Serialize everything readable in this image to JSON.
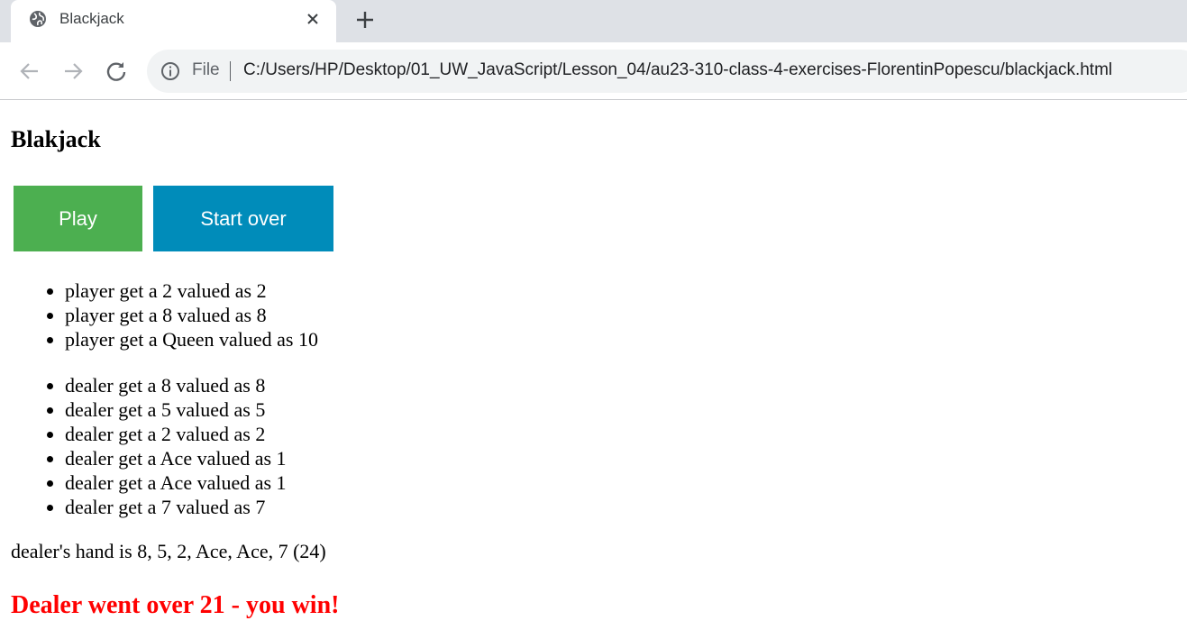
{
  "browser": {
    "tab_title": "Blackjack",
    "address": {
      "scheme_label": "File",
      "url": "C:/Users/HP/Desktop/01_UW_JavaScript/Lesson_04/au23-310-class-4-exercises-FlorentinPopescu/blackjack.html"
    },
    "icons": {
      "favicon": "globe-icon",
      "close": "close-icon",
      "new_tab": "plus-icon",
      "back": "back-arrow-icon",
      "forward": "forward-arrow-icon",
      "reload": "reload-icon",
      "info": "info-icon"
    }
  },
  "page": {
    "title": "Blakjack",
    "buttons": {
      "play": "Play",
      "start_over": "Start over"
    },
    "button_colors": {
      "play": "#4caf50",
      "start_over": "#008cba"
    },
    "player_cards": [
      "player get a 2 valued as 2",
      "player get a 8 valued as 8",
      "player get a Queen valued as 10"
    ],
    "dealer_cards": [
      "dealer get a 8 valued as 8",
      "dealer get a 5 valued as 5",
      "dealer get a 2 valued as 2",
      "dealer get a Ace valued as 1",
      "dealer get a Ace valued as 1",
      "dealer get a 7 valued as 7"
    ],
    "dealer_hand_summary": "dealer's hand is 8, 5, 2, Ace, Ace, 7 (24)",
    "result": {
      "text": "Dealer went over 21 - you win!",
      "color": "#ff0000"
    }
  }
}
